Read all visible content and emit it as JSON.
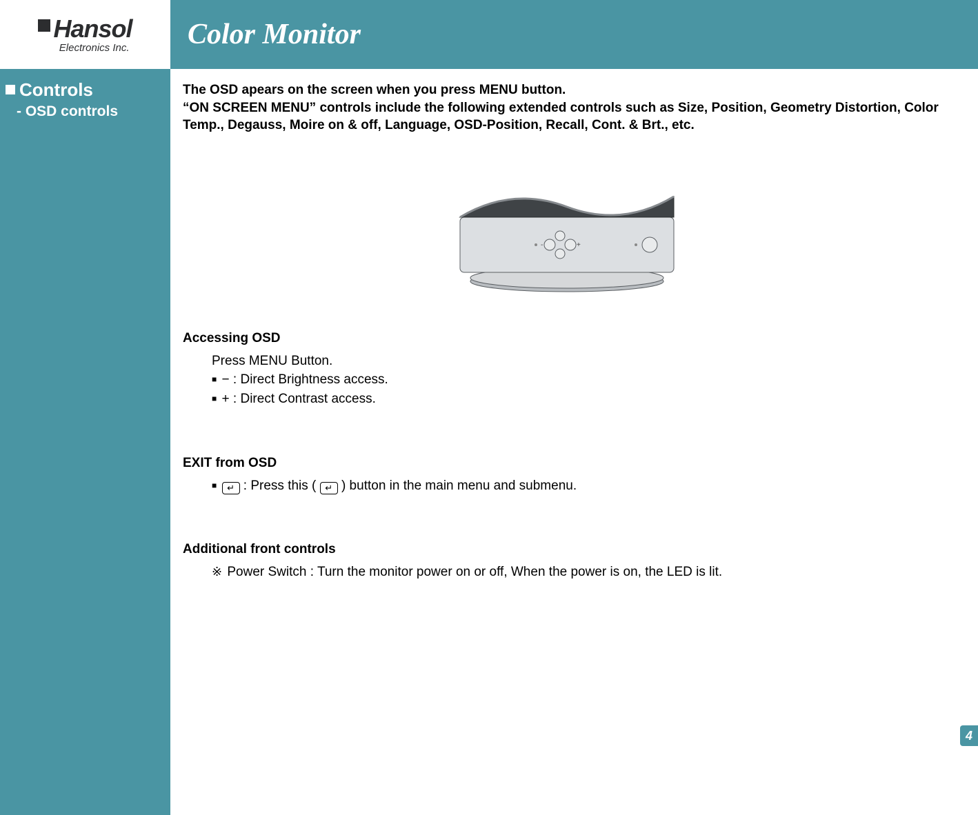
{
  "logo": {
    "brand": "Hansol",
    "subtitle": "Electronics Inc."
  },
  "header": {
    "title": "Color Monitor"
  },
  "sidebar": {
    "section": "Controls",
    "subsection": "- OSD controls"
  },
  "content": {
    "intro_line1": "The OSD apears on the screen when you press  MENU button.",
    "intro_line2": "“ON SCREEN MENU” controls include the following extended controls such as Size, Position, Geometry Distortion, Color Temp., Degauss, Moire on & off, Language, OSD-Position, Recall, Cont. & Brt., etc.",
    "section1_title": "Accessing OSD",
    "section1_line1": "Press MENU Button.",
    "section1_line2_symbol": "−",
    "section1_line2_text": " : Direct Brightness access.",
    "section1_line3_symbol": "+",
    "section1_line3_text": " : Direct Contrast access.",
    "section2_title": "EXIT from OSD",
    "section2_line1a": " : Press this ( ",
    "section2_line1b": " ) button in the main menu and submenu.",
    "section3_title": "Additional front controls",
    "section3_line1": " Power Switch : Turn the monitor power on or off, When the power is on, the LED is lit."
  },
  "page_number": "4"
}
